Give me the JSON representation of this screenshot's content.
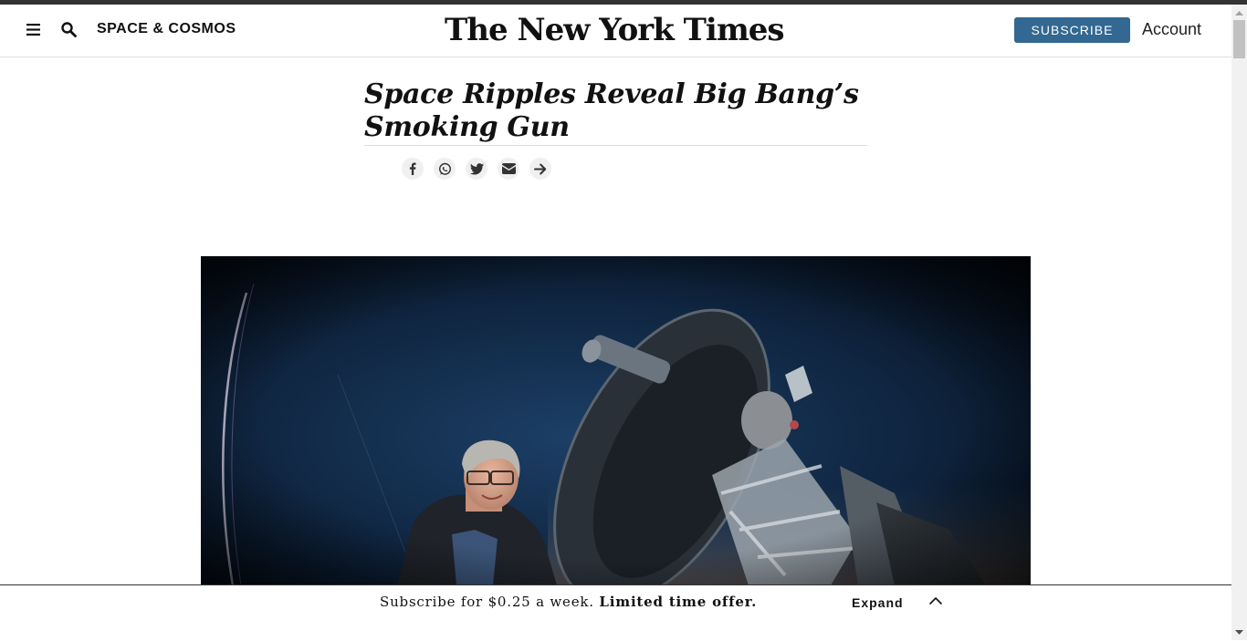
{
  "header": {
    "section_label": "SPACE & COSMOS",
    "logo_text": "The New York Times",
    "subscribe_label": "SUBSCRIBE",
    "account_label": "Account"
  },
  "article": {
    "headline": "Space Ripples Reveal Big Bang’s Smoking Gun",
    "share_buttons": [
      {
        "icon": "facebook-icon"
      },
      {
        "icon": "whatsapp-icon"
      },
      {
        "icon": "twitter-icon"
      },
      {
        "icon": "email-icon"
      },
      {
        "icon": "share-arrow-icon"
      }
    ]
  },
  "subscribe_bar": {
    "offer_prefix": "Subscribe for $0.25 a week. ",
    "offer_strong": "Limited time offer.",
    "expand_label": "Expand"
  },
  "colors": {
    "subscribe_button": "#326891",
    "text": "#111111",
    "top_line": "#333333"
  }
}
